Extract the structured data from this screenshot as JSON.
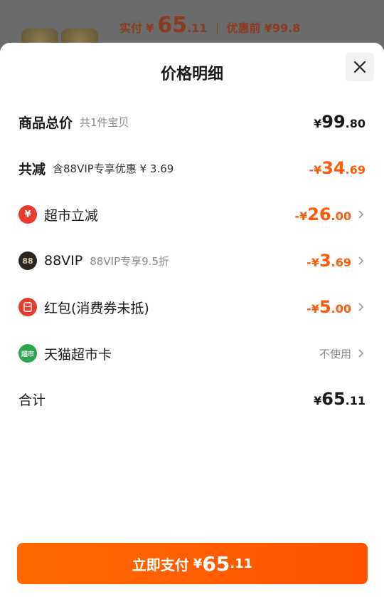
{
  "background": {
    "paid_label": "实付",
    "currency": "¥",
    "paid_int": "65",
    "paid_dec": ".11",
    "before_label": "优惠前",
    "before_value": "¥99.8"
  },
  "sheet": {
    "title": "价格明细",
    "close_icon": "close-icon"
  },
  "rows": {
    "total": {
      "label": "商品总价",
      "sub": "共1件宝贝",
      "currency": "¥",
      "int": "99",
      "dec": ".80"
    },
    "reduce": {
      "label": "共减",
      "sub": "含88VIP专享优惠 ¥ 3.69",
      "currency": "-¥",
      "int": "34",
      "dec": ".69"
    },
    "supermarket": {
      "icon_text": "¥",
      "label": "超市立减",
      "currency": "-¥",
      "int": "26",
      "dec": ".00"
    },
    "vip": {
      "icon_text": "88",
      "label": "88VIP",
      "sub": "88VIP专享9.5折",
      "currency": "-¥",
      "int": "3",
      "dec": ".69"
    },
    "redpacket": {
      "label": "红包(消费券未抵)",
      "currency": "-¥",
      "int": "5",
      "dec": ".00"
    },
    "card": {
      "icon_text": "超市",
      "label": "天猫超市卡",
      "status": "不使用"
    },
    "sum": {
      "label": "合计",
      "currency": "¥",
      "int": "65",
      "dec": ".11"
    }
  },
  "pay_button": {
    "label": "立即支付",
    "currency": "¥",
    "int": "65",
    "dec": ".11"
  },
  "colors": {
    "accent": "#ff5a0a",
    "button": "#ff6a00",
    "red_icon": "#e83a2e",
    "green_icon": "#2ea24d"
  }
}
